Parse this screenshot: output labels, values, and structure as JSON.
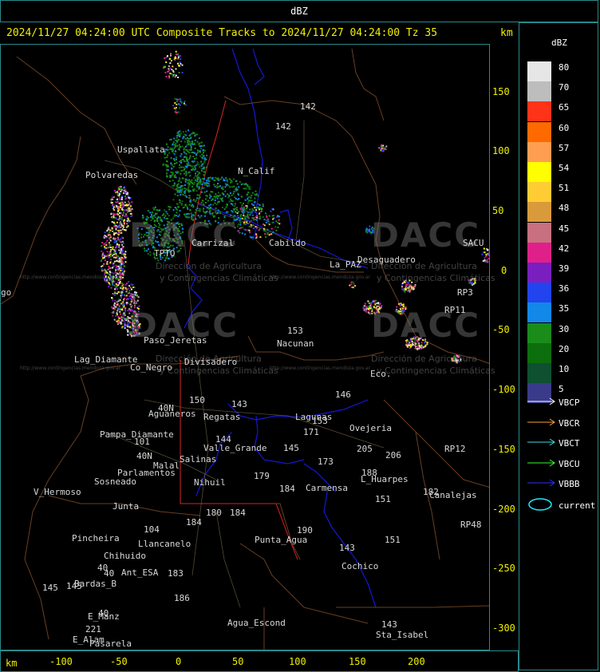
{
  "header": {
    "unit": "dBZ",
    "title": "2024/11/27 04:24:00 UTC Composite Tracks to 2024/11/27 04:24:00 Tz 35",
    "km_label": "km"
  },
  "legend": {
    "unit": "dBZ",
    "scale": [
      {
        "value": "80",
        "color": "#e6e6e6"
      },
      {
        "value": "70",
        "color": "#bdbdbd"
      },
      {
        "value": "65",
        "color": "#ff3318"
      },
      {
        "value": "60",
        "color": "#ff6a00"
      },
      {
        "value": "57",
        "color": "#ff9e50"
      },
      {
        "value": "54",
        "color": "#ffff00"
      },
      {
        "value": "51",
        "color": "#ffcc33"
      },
      {
        "value": "48",
        "color": "#d89a3a"
      },
      {
        "value": "45",
        "color": "#c87080"
      },
      {
        "value": "42",
        "color": "#e0208a"
      },
      {
        "value": "39",
        "color": "#7a1fbf"
      },
      {
        "value": "36",
        "color": "#2244ee"
      },
      {
        "value": "35",
        "color": "#1288e8"
      },
      {
        "value": "30",
        "color": "#1a8c1a"
      },
      {
        "value": "20",
        "color": "#0d6e0d"
      },
      {
        "value": "10",
        "color": "#0e5030"
      },
      {
        "value": "5",
        "color": "#3a3a8a"
      }
    ],
    "tracks": [
      {
        "label": "VBCP",
        "color": "#ffffff"
      },
      {
        "label": "VBCR",
        "color": "#ff9e30"
      },
      {
        "label": "VBCT",
        "color": "#40d8e8"
      },
      {
        "label": "VBCU",
        "color": "#30ff30"
      },
      {
        "label": "VBBB",
        "color": "#3030ff"
      }
    ],
    "current_label": "current",
    "current_color": "#20e8ff"
  },
  "axes": {
    "x_unit": "km",
    "x_ticks": [
      "-100",
      "-50",
      "0",
      "50",
      "100",
      "150",
      "200"
    ],
    "y_ticks": [
      "150",
      "100",
      "50",
      "0",
      "-50",
      "-100",
      "-150",
      "-200",
      "-250",
      "-300"
    ]
  },
  "watermarks": {
    "text": "DACC",
    "sub1": "Dirección de Agricultura",
    "sub2": "y Contingencias Climáticas",
    "url": "http://www.contingencias.mendoza.gov.ar"
  },
  "places": [
    {
      "name": "Uspallata"
    },
    {
      "name": "Polvaredas"
    },
    {
      "name": "N_Calif"
    },
    {
      "name": "Cabildo"
    },
    {
      "name": "Carrizal"
    },
    {
      "name": "TPTO"
    },
    {
      "name": "La_PAZ"
    },
    {
      "name": "Desaguadero"
    },
    {
      "name": "SACU"
    },
    {
      "name": "RP11"
    },
    {
      "name": "RP3"
    },
    {
      "name": "Nacunan"
    },
    {
      "name": "Paso_Jeretas"
    },
    {
      "name": "Lag_Diamante"
    },
    {
      "name": "Co_Negro"
    },
    {
      "name": "Divisadero"
    },
    {
      "name": "Aguaneros"
    },
    {
      "name": "Pampa_Diamante"
    },
    {
      "name": "Valle_Grande"
    },
    {
      "name": "Salinas"
    },
    {
      "name": "Parlamentos"
    },
    {
      "name": "Sosneado"
    },
    {
      "name": "V_Hermoso"
    },
    {
      "name": "Junta"
    },
    {
      "name": "Malal"
    },
    {
      "name": "Nihuil"
    },
    {
      "name": "Ovejeria"
    },
    {
      "name": "Carmensa"
    },
    {
      "name": "L_Huarpes"
    },
    {
      "name": "Canalejas"
    },
    {
      "name": "RP12"
    },
    {
      "name": "RP48"
    },
    {
      "name": "Pincheira"
    },
    {
      "name": "Llancanelo"
    },
    {
      "name": "Chihuido"
    },
    {
      "name": "Ant_ESA"
    },
    {
      "name": "Bardas_B"
    },
    {
      "name": "E_Manz"
    },
    {
      "name": "E_Alam"
    },
    {
      "name": "Pasarela"
    },
    {
      "name": "Punta_Agua"
    },
    {
      "name": "Cochico"
    },
    {
      "name": "Agua_Escond"
    },
    {
      "name": "Sta_Isabel"
    },
    {
      "name": "Eco."
    },
    {
      "name": "Regatas"
    },
    {
      "name": "Lagunas"
    },
    {
      "name": "go"
    }
  ],
  "route_numbers": [
    "142",
    "142",
    "153",
    "146",
    "150",
    "143",
    "144",
    "145",
    "171",
    "173",
    "205",
    "206",
    "188",
    "151",
    "151",
    "182",
    "184",
    "190",
    "179",
    "180",
    "186",
    "183",
    "143",
    "184",
    "145",
    "221",
    "40",
    "40",
    "40",
    "40N",
    "40N",
    "101",
    "104",
    "143",
    "145",
    "153",
    "184"
  ]
}
